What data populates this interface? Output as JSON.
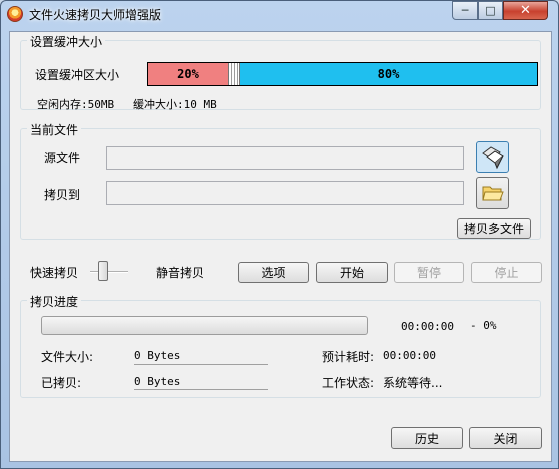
{
  "window": {
    "title": "文件火速拷贝大师增强版",
    "caption_buttons": {
      "minimize": "─",
      "maximize": "□",
      "close": "✕"
    }
  },
  "buffer": {
    "group_title": "设置缓冲大小",
    "label": "设置缓冲区大小",
    "left_percent": "20%",
    "right_percent": "80%",
    "free_memory": "空闲内存:50MB",
    "buffer_size": "缓冲大小:10 MB",
    "left_color": "#f08080",
    "right_color": "#1fbfef"
  },
  "files": {
    "group_title": "当前文件",
    "source_label": "源文件",
    "source_value": "",
    "dest_label": "拷贝到",
    "dest_value": "",
    "source_icon": "copy-files-icon",
    "dest_icon": "folder-icon",
    "multi_copy_button": "拷贝多文件"
  },
  "controls": {
    "fast_label": "快速拷贝",
    "silent_label": "静音拷贝",
    "options_button": "选项",
    "start_button": "开始",
    "pause_button": "暂停",
    "stop_button": "停止"
  },
  "progress": {
    "group_title": "拷贝进度",
    "elapsed": "00:00:00",
    "percent": "- 0%",
    "fraction": 0,
    "file_size_label": "文件大小:",
    "file_size_value": "0 Bytes",
    "copied_label": "已拷贝:",
    "copied_value": "0 Bytes",
    "eta_label": "预计耗时:",
    "eta_value": "00:00:00",
    "status_label": "工作状态:",
    "status_value": "系统等待..."
  },
  "footer": {
    "history_button": "历史",
    "close_button": "关闭"
  }
}
